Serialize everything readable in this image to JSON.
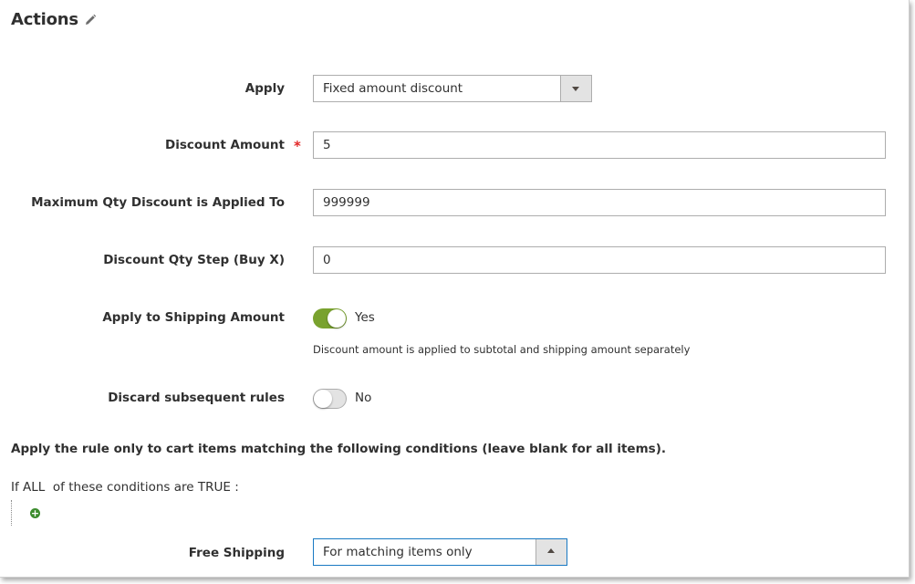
{
  "section": {
    "title": "Actions",
    "edit_icon": "pencil-icon"
  },
  "fields": {
    "apply": {
      "label": "Apply",
      "value": "Fixed amount discount"
    },
    "discount_amount": {
      "label": "Discount Amount",
      "required_mark": "*",
      "value": "5"
    },
    "max_qty": {
      "label": "Maximum Qty Discount is Applied To",
      "value": "999999"
    },
    "qty_step": {
      "label": "Discount Qty Step (Buy X)",
      "value": "0"
    },
    "apply_shipping": {
      "label": "Apply to Shipping Amount",
      "state": "Yes",
      "note": "Discount amount is applied to subtotal and shipping amount separately",
      "on_color": "#79a22e"
    },
    "discard_rules": {
      "label": "Discard subsequent rules",
      "state": "No"
    },
    "free_shipping": {
      "label": "Free Shipping",
      "value": "For matching items only"
    }
  },
  "conditions": {
    "heading": "Apply the rule only to cart items matching the following conditions (leave blank for all items).",
    "line_prefix": "If ",
    "aggregator": "ALL",
    "line_middle": "  of these conditions are ",
    "value": "TRUE",
    "line_suffix": " :",
    "add_icon": "plus-circle-icon"
  }
}
